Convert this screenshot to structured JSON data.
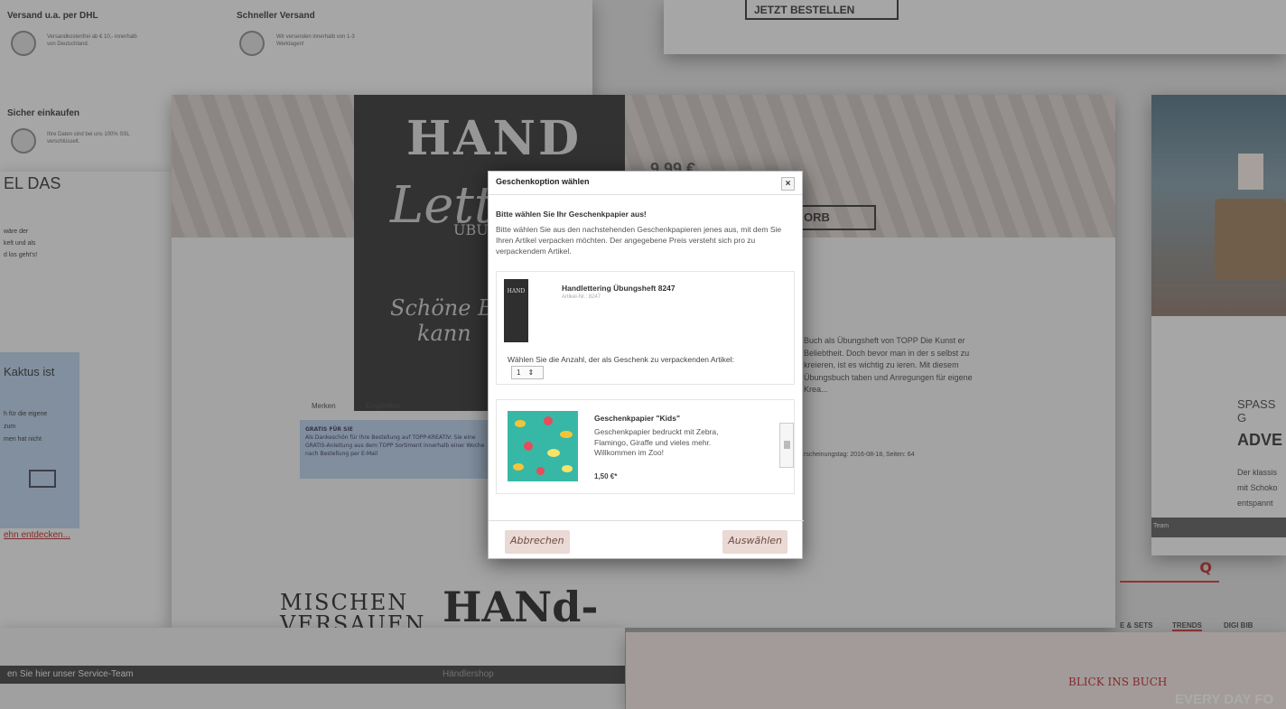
{
  "background": {
    "shipping": [
      {
        "title": "Versand u.a. per DHL",
        "text": "Versandkostenfrei ab € 10,- innerhalb von Deutschland."
      },
      {
        "title": "Schneller Versand",
        "text": "Wir versenden innerhalb von 1-3 Werktagen!"
      },
      {
        "title": "Sicher einkaufen",
        "text": "Ihre Daten sind bei uns 100% SSL verschlüsselt."
      }
    ],
    "left_heading": "EL DAS",
    "left_text": [
      "wäre der",
      "kelt und als",
      "d los geht's!"
    ],
    "kaktus_heading": "Kaktus ist",
    "kaktus_text": [
      "h für die eigene",
      "zum",
      "men hat nicht"
    ],
    "kaktus_link": "ehn entdecken...",
    "book": {
      "hand": "HAND",
      "lettering": "Letter",
      "uebung": "ÜBUNGS",
      "schoene": "Schöne B",
      "kann": "kann"
    },
    "top_button": "JETZT BESTELLEN",
    "mid_button": "ORB",
    "mid_price": "9,99 €",
    "merken": "Merken",
    "empfehlen": "Empfehlen",
    "gratis_title": "GRATIS FÜR SIE",
    "gratis_text": "Als Dankeschön für Ihre Bestellung auf TOPP-KREATIV: Sie eine GRATIS-Anleitung aus dem TOPP Sortiment innerhalb einer Woche nach Bestellung per E-Mail",
    "description": "Buch als Übungsheft von TOPP Die Kunst er Beliebtheit. Doch bevor man in der s selbst zu kreieren, ist es wichtig zu ieren. Mit diesem Übungsbuch taben und Anregungen für eigene Krea...",
    "erscheinung": "rscheinungstag: 2016-08-18, Seiten: 64",
    "bottom_left_text": "en Sie hier unser Service-Team",
    "bottom_center_text": "Händlershop",
    "right_spass": "SPASS G",
    "right_adve": "ADVE",
    "right_lines": [
      "Der klassis",
      "mit Schoko",
      "entspannt"
    ],
    "service_small": "Team",
    "nav_items": [
      "E & SETS",
      "TRENDS",
      "DIGI BIB"
    ],
    "blick": "BLICK INS BUCH",
    "every": "EVERY DAY FO",
    "mischen": "MISCHEN",
    "versauen": "VERSAUEN",
    "hand_big": "HANd-"
  },
  "modal": {
    "title": "Geschenkoption wählen",
    "close_label": "×",
    "heading": "Bitte wählen Sie Ihr Geschenkpapier aus!",
    "intro": "Bitte wählen Sie aus den nachstehenden Geschenkpapieren jenes aus, mit dem Sie Ihren Artikel verpacken möchten. Der angegebene Preis versteht sich pro zu verpackendem Artikel.",
    "product": {
      "name": "Handlettering Übungsheft 8247",
      "article": "Artikel-Nr.: 8247",
      "thumb_text": "HAND"
    },
    "quantity_label": "Wählen Sie die Anzahl, der als Geschenk zu verpackenden Artikel:",
    "quantity_value": "1",
    "quantity_arrow": "⇕",
    "paper": {
      "name": "Geschenkpapier \"Kids\"",
      "description": "Geschenkpapier bedruckt mit Zebra, Flamingo, Giraffe und vieles mehr. Willkommen im Zoo!",
      "price": "1,50 €*"
    },
    "cancel_label": "Abbrechen",
    "select_label": "Auswählen"
  }
}
